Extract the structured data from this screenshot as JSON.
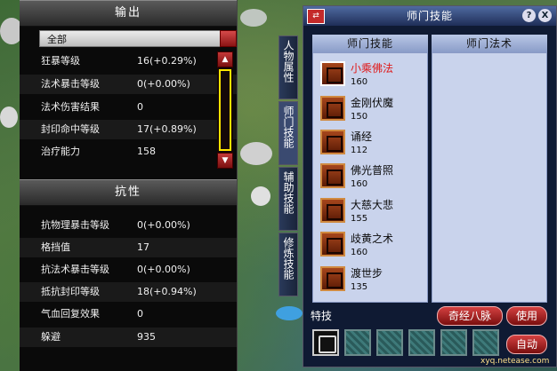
{
  "output_panel": {
    "title": "输出",
    "filter": "全部",
    "stats": [
      {
        "k": "狂暴等级",
        "v": "16(+0.29%)"
      },
      {
        "k": "法术暴击等级",
        "v": "0(+0.00%)"
      },
      {
        "k": "法术伤害结果",
        "v": "0"
      },
      {
        "k": "封印命中等级",
        "v": "17(+0.89%)"
      },
      {
        "k": "治疗能力",
        "v": "158"
      }
    ]
  },
  "resist_panel": {
    "title": "抗性",
    "stats": [
      {
        "k": "抗物理暴击等级",
        "v": "0(+0.00%)"
      },
      {
        "k": "格挡值",
        "v": "17"
      },
      {
        "k": "抗法术暴击等级",
        "v": "0(+0.00%)"
      },
      {
        "k": "抵抗封印等级",
        "v": "18(+0.94%)"
      },
      {
        "k": "气血回复效果",
        "v": "0"
      },
      {
        "k": "躲避",
        "v": "935"
      }
    ]
  },
  "skill_window": {
    "title": "师门技能",
    "title_icon": "⇄",
    "help": "?",
    "close": "X",
    "col_left": "师门技能",
    "col_right": "师门法术",
    "skills": [
      {
        "name": "小乘佛法",
        "level": "160",
        "selected": true
      },
      {
        "name": "金刚伏魔",
        "level": "150"
      },
      {
        "name": "诵经",
        "level": "112"
      },
      {
        "name": "佛光普照",
        "level": "160"
      },
      {
        "name": "大慈大悲",
        "level": "155"
      },
      {
        "name": "歧黄之术",
        "level": "160"
      },
      {
        "name": "渡世步",
        "level": "135"
      }
    ],
    "special_label": "特技",
    "meridian_button": "奇经八脉",
    "use_button": "使用",
    "auto_button": "自动"
  },
  "side_tabs": [
    "人物属性",
    "师门技能",
    "辅助技能",
    "修炼技能"
  ],
  "watermark": "xyq.netease.com"
}
